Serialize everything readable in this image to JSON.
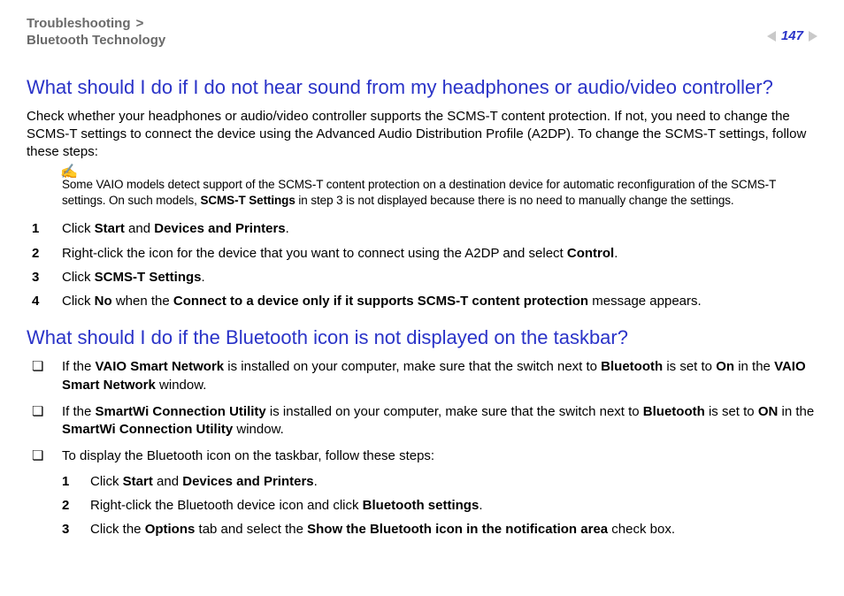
{
  "breadcrumb": {
    "section": "Troubleshooting",
    "sep": ">",
    "sub": "Bluetooth Technology"
  },
  "page_number": "147",
  "q1": {
    "title": "What should I do if I do not hear sound from my headphones or audio/video controller?",
    "intro": "Check whether your headphones or audio/video controller supports the SCMS-T content protection. If not, you need to change the SCMS-T settings to connect the device using the Advanced Audio Distribution Profile (A2DP). To change the SCMS-T settings, follow these steps:",
    "note_pre": "Some VAIO models detect support of the SCMS-T content protection on a destination device for automatic reconfiguration of the SCMS-T settings. On such models, ",
    "note_bold": "SCMS-T Settings",
    "note_post": " in step 3 is not displayed because there is no need to manually change the settings.",
    "steps": {
      "s1": {
        "n": "1",
        "a": "Click ",
        "b1": "Start",
        "b": " and ",
        "b2": "Devices and Printers",
        "c": "."
      },
      "s2": {
        "n": "2",
        "a": "Right-click the icon for the device that you want to connect using the A2DP and select ",
        "b1": "Control",
        "c": "."
      },
      "s3": {
        "n": "3",
        "a": "Click ",
        "b1": "SCMS-T Settings",
        "c": "."
      },
      "s4": {
        "n": "4",
        "a": "Click ",
        "b1": "No",
        "b": " when the ",
        "b2": "Connect to a device only if it supports SCMS-T content protection",
        "c": " message appears."
      }
    }
  },
  "q2": {
    "title": "What should I do if the Bluetooth icon is not displayed on the taskbar?",
    "items": {
      "i1": {
        "a": "If the ",
        "b1": "VAIO Smart Network",
        "b": " is installed on your computer, make sure that the switch next to ",
        "b2": "Bluetooth",
        "c": " is set to ",
        "b3": "On",
        "d": " in the ",
        "b4": "VAIO Smart Network",
        "e": " window."
      },
      "i2": {
        "a": "If the ",
        "b1": "SmartWi Connection Utility",
        "b": " is installed on your computer, make sure that the switch next to ",
        "b2": "Bluetooth",
        "c": " is set to ",
        "b3": "ON",
        "d": " in the ",
        "b4": "SmartWi Connection Utility",
        "e": " window."
      },
      "i3": {
        "a": "To display the Bluetooth icon on the taskbar, follow these steps:"
      }
    },
    "sub": {
      "s1": {
        "n": "1",
        "a": "Click ",
        "b1": "Start",
        "b": " and ",
        "b2": "Devices and Printers",
        "c": "."
      },
      "s2": {
        "n": "2",
        "a": "Right-click the Bluetooth device icon and click ",
        "b1": "Bluetooth settings",
        "c": "."
      },
      "s3": {
        "n": "3",
        "a": "Click the ",
        "b1": "Options",
        "b": " tab and select the ",
        "b2": "Show the Bluetooth icon in the notification area",
        "c": " check box."
      }
    }
  }
}
